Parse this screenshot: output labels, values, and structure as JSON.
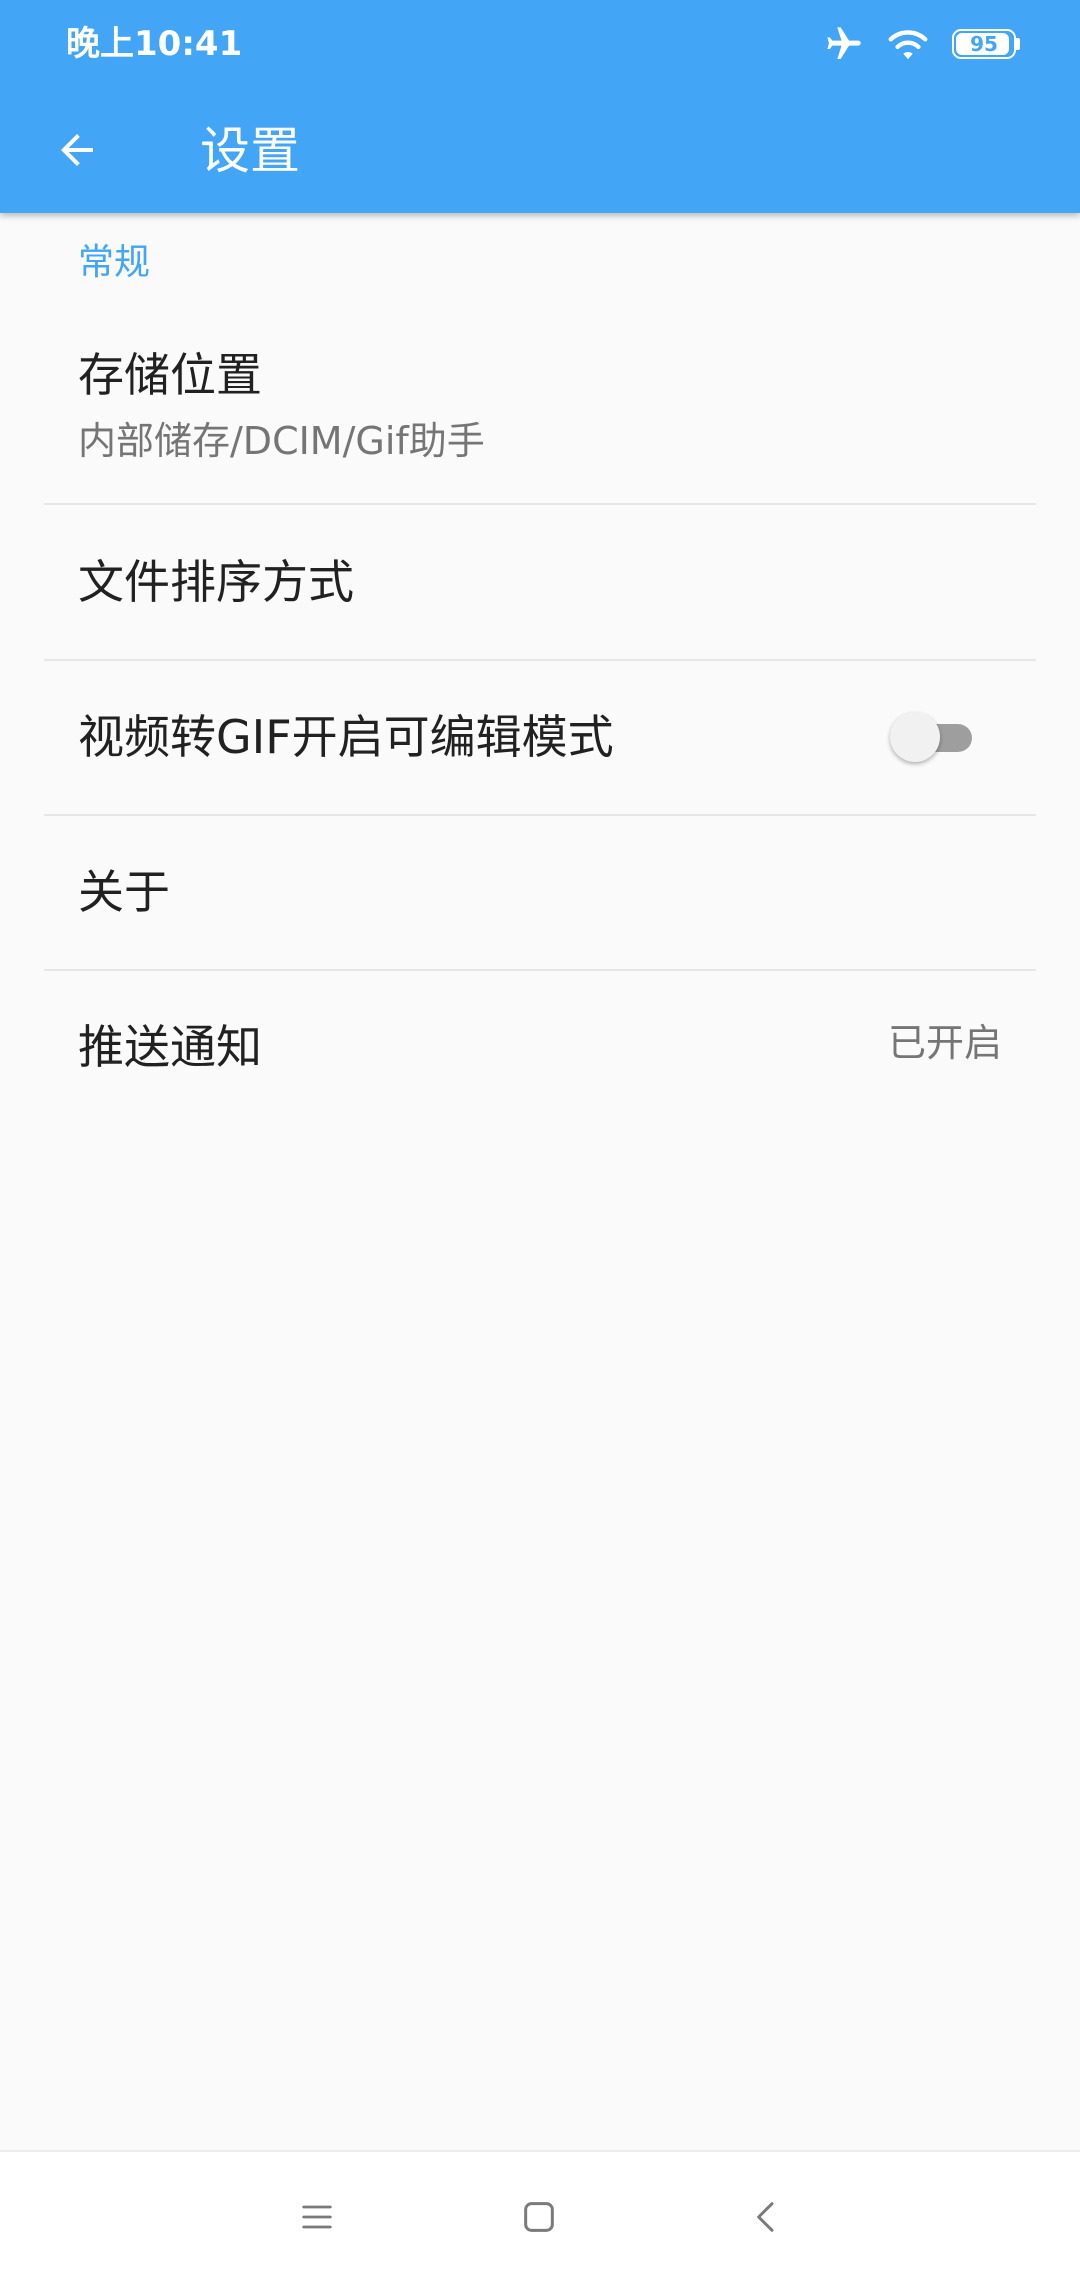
{
  "status_bar": {
    "time": "晚上10:41",
    "battery_level": "95",
    "icons": [
      "airplane-icon",
      "wifi-icon",
      "battery-icon"
    ]
  },
  "toolbar": {
    "back_icon": "arrow-left-icon",
    "title": "设置"
  },
  "settings": {
    "section_title": "常规",
    "items": [
      {
        "title": "存储位置",
        "summary": "内部储存/DCIM/Gif助手"
      },
      {
        "title": "文件排序方式"
      },
      {
        "title": "视频转GIF开启可编辑模式",
        "switch_on": false
      },
      {
        "title": "关于"
      },
      {
        "title": "推送通知",
        "value": "已开启"
      }
    ]
  },
  "nav_bar": {
    "icons": [
      "menu-icon",
      "home-icon",
      "back-icon"
    ]
  },
  "colors": {
    "primary": "#42a5f5",
    "accent": "#42a5f5",
    "background": "#fafafa",
    "text_primary": "#212121",
    "text_secondary": "#757575",
    "switch_thumb_off": "#f1f1f1",
    "switch_track_off": "#9e9e9e",
    "nav_icon": "#7a7a7a"
  }
}
